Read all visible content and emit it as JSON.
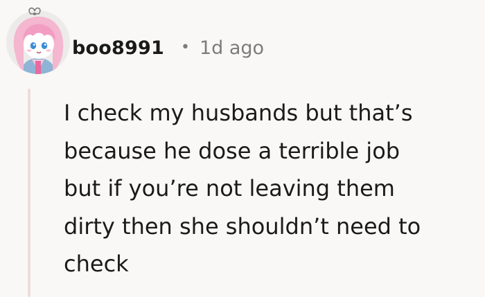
{
  "comment": {
    "username": "boo8991",
    "separator": "•",
    "timestamp": "1d ago",
    "avatar_icon": "anime-girl-avatar-icon",
    "body_lines": [
      "I check my husbands but that’s",
      "because he dose a terrible job",
      "but if you’re not leaving them",
      "dirty then she shouldn’t need to",
      "check"
    ]
  },
  "colors": {
    "background": "#f9f8f6",
    "thread_line": "#eddcdc",
    "text": "#1a1a1b",
    "meta": "#7c7c7c",
    "avatar_hair": "#f5b6d0",
    "avatar_eyes": "#3d8bd8"
  }
}
